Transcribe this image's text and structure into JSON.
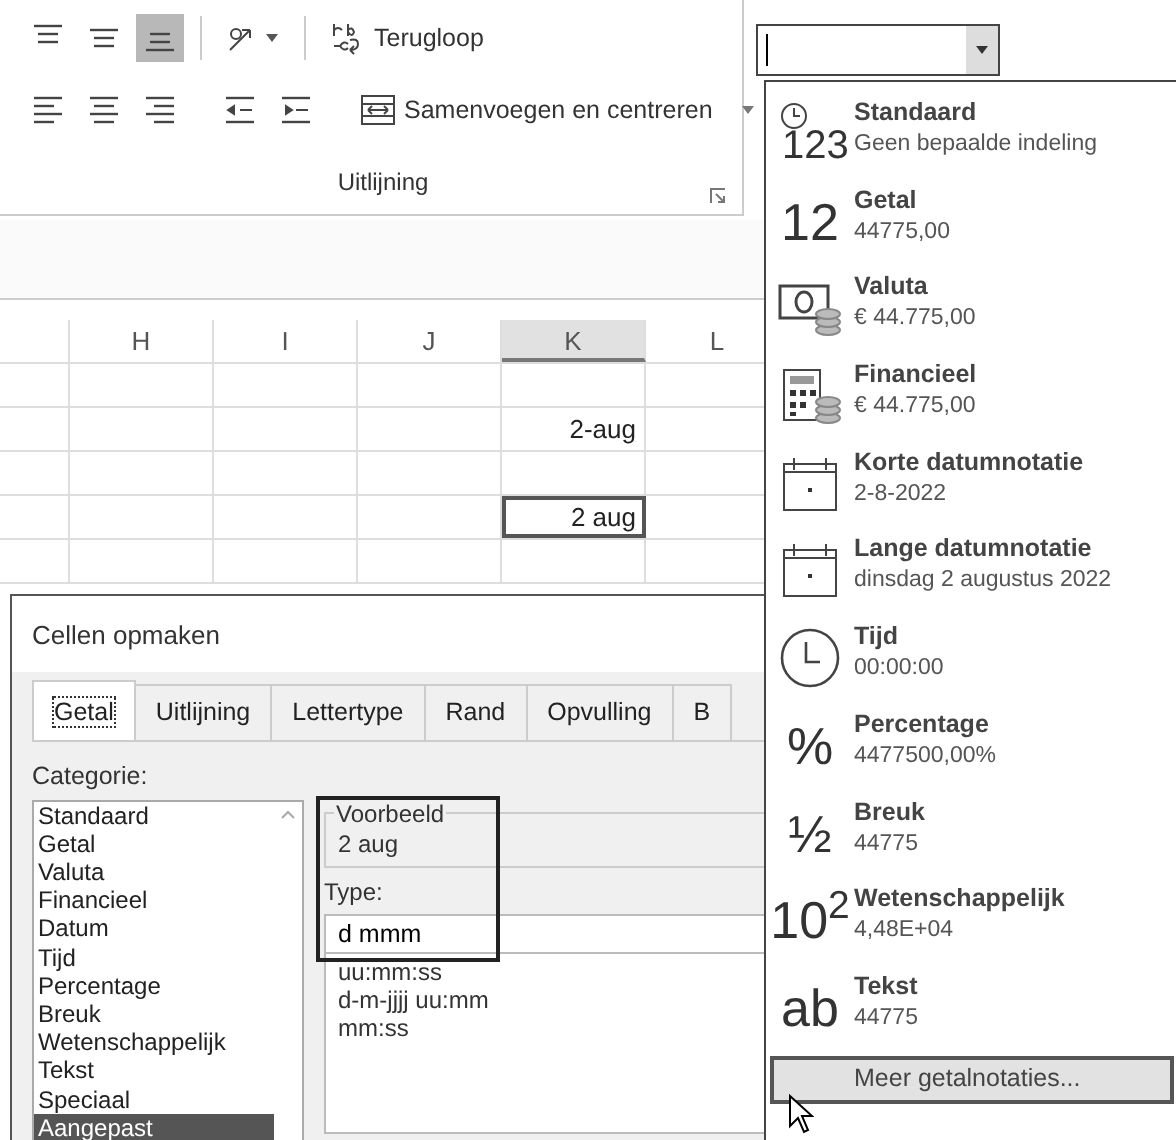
{
  "ribbon": {
    "group_label": "Uitlijning",
    "top_buttons": [
      {
        "kind": "align-top",
        "selected": false
      },
      {
        "kind": "align-middle",
        "selected": false
      },
      {
        "kind": "align-bottom",
        "selected": true
      },
      {
        "kind": "orientation",
        "selected": false
      }
    ],
    "bottom_buttons": [
      {
        "kind": "align-left",
        "selected": false
      },
      {
        "kind": "align-center",
        "selected": false
      },
      {
        "kind": "align-right",
        "selected": false
      },
      {
        "kind": "indent-decrease",
        "selected": false
      },
      {
        "kind": "indent-increase",
        "selected": false
      }
    ],
    "wrap_button": {
      "label": "Terugloop"
    },
    "merge_button": {
      "label": "Samenvoegen en centreren"
    }
  },
  "sheet": {
    "columns": [
      {
        "label": "H",
        "selected": false
      },
      {
        "label": "I",
        "selected": false
      },
      {
        "label": "J",
        "selected": false
      },
      {
        "label": "K",
        "selected": true
      },
      {
        "label": "L",
        "selected": false
      }
    ],
    "rows": [
      {
        "selected": false
      },
      {
        "column_k": "2-aug",
        "selected": false
      },
      {
        "selected": false
      },
      {
        "column_k": "2 aug",
        "selected": true
      },
      {
        "selected": false
      }
    ]
  },
  "dialog": {
    "title": "Cellen opmaken",
    "tabs": [
      {
        "label": "Getal",
        "selected": true
      },
      {
        "label": "Uitlijning",
        "selected": false
      },
      {
        "label": "Lettertype",
        "selected": false
      },
      {
        "label": "Rand",
        "selected": false
      },
      {
        "label": "Opvulling",
        "selected": false
      },
      {
        "label": "B",
        "selected": false
      }
    ],
    "category_label": "Categorie:",
    "categories": [
      {
        "label": "Standaard",
        "selected": false
      },
      {
        "label": "Getal",
        "selected": false
      },
      {
        "label": "Valuta",
        "selected": false
      },
      {
        "label": "Financieel",
        "selected": false
      },
      {
        "label": "Datum",
        "selected": false
      },
      {
        "label": "Tijd",
        "selected": false
      },
      {
        "label": "Percentage",
        "selected": false
      },
      {
        "label": "Breuk",
        "selected": false
      },
      {
        "label": "Wetenschappelijk",
        "selected": false
      },
      {
        "label": "Tekst",
        "selected": false
      },
      {
        "label": "Speciaal",
        "selected": false
      },
      {
        "label": "Aangepast",
        "selected": true
      }
    ],
    "sample_label": "Voorbeeld",
    "sample_value": "2 aug",
    "type_label": "Type:",
    "type_value": "d mmm",
    "type_list": [
      "uu:mm:ss",
      "d-m-jjjj uu:mm",
      "mm:ss"
    ]
  },
  "format_menu": {
    "items": [
      {
        "kind": "clock-number",
        "glyph": "123",
        "title": "Standaard",
        "example": "Geen bepaalde indeling"
      },
      {
        "kind": "text",
        "glyph": "12",
        "title": "Getal",
        "example": "44775,00"
      },
      {
        "kind": "currency",
        "title": "Valuta",
        "example": "€ 44.775,00"
      },
      {
        "kind": "calculator",
        "title": "Financieel",
        "example": " € 44.775,00"
      },
      {
        "kind": "calendar",
        "title": "Korte datumnotatie",
        "example": "2-8-2022"
      },
      {
        "kind": "calendar",
        "title": "Lange datumnotatie",
        "example": "dinsdag 2 augustus 2022"
      },
      {
        "kind": "clock",
        "title": "Tijd",
        "example": "00:00:00"
      },
      {
        "kind": "text",
        "glyph": "%",
        "title": "Percentage",
        "example": "4477500,00%"
      },
      {
        "kind": "fraction",
        "glyph": "½",
        "title": "Breuk",
        "example": "44775"
      },
      {
        "kind": "text",
        "glyph": "10$^{2}$",
        "title": "Wetenschappelijk",
        "example": "4,48E+04"
      },
      {
        "kind": "text",
        "glyph": "ab",
        "title": "Tekst",
        "example": "44775"
      }
    ],
    "more": {
      "label": "Meer getalnotaties...",
      "hovered": true
    }
  }
}
